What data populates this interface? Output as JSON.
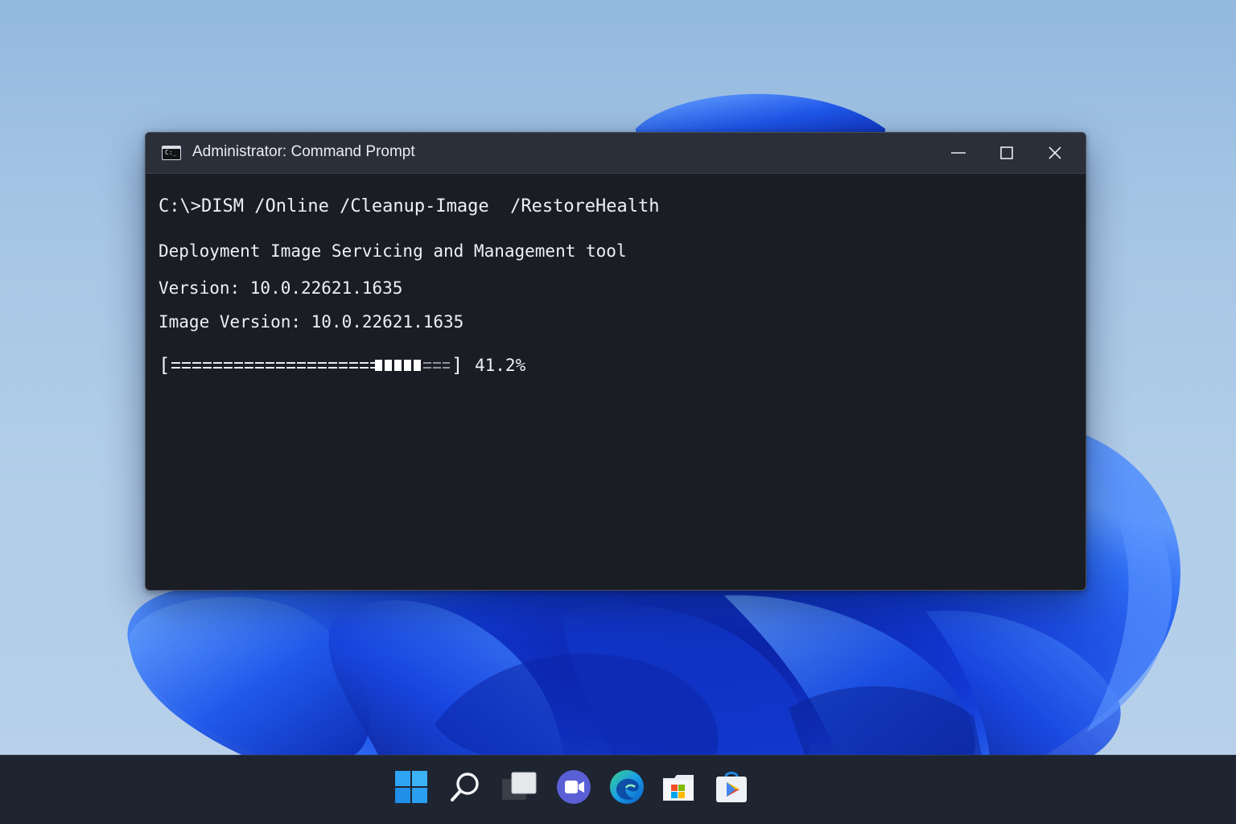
{
  "window": {
    "title": "Administrator: Command Prompt",
    "icon": "command-prompt-icon",
    "icon_glyph": "C:_",
    "controls": {
      "minimize": "minimize-icon",
      "maximize": "maximize-icon",
      "close": "close-icon"
    }
  },
  "console": {
    "command": "C:\\>DISM /Online /Cleanup-Image  /RestoreHealth",
    "tool_name": "Deployment Image Servicing and Management tool",
    "version": "Version: 10.0.22621.1635",
    "image_version": "Image Version: 10.0.22621.1635",
    "progress": {
      "bracket_open": "[",
      "bracket_close": "]",
      "percent_label": "41.2%",
      "segments": {
        "equals_done": 19,
        "blocks_active": 5,
        "equals_remaining": 3
      }
    }
  },
  "taskbar": {
    "items": [
      {
        "name": "start-button",
        "icon": "windows-logo-icon"
      },
      {
        "name": "search-button",
        "icon": "search-icon"
      },
      {
        "name": "task-view-button",
        "icon": "task-view-icon"
      },
      {
        "name": "teams-chat-button",
        "icon": "video-camera-icon"
      },
      {
        "name": "edge-button",
        "icon": "edge-browser-icon"
      },
      {
        "name": "file-explorer-button",
        "icon": "folder-icon"
      },
      {
        "name": "store-button",
        "icon": "store-bag-icon"
      }
    ]
  },
  "colors": {
    "terminal_background": "#1b1d25",
    "titlebar_background": "#2b2f3a",
    "terminal_text": "#eef0f3",
    "taskbar_background": "#1e2430",
    "wallpaper_accent": "#1e4fe0"
  }
}
